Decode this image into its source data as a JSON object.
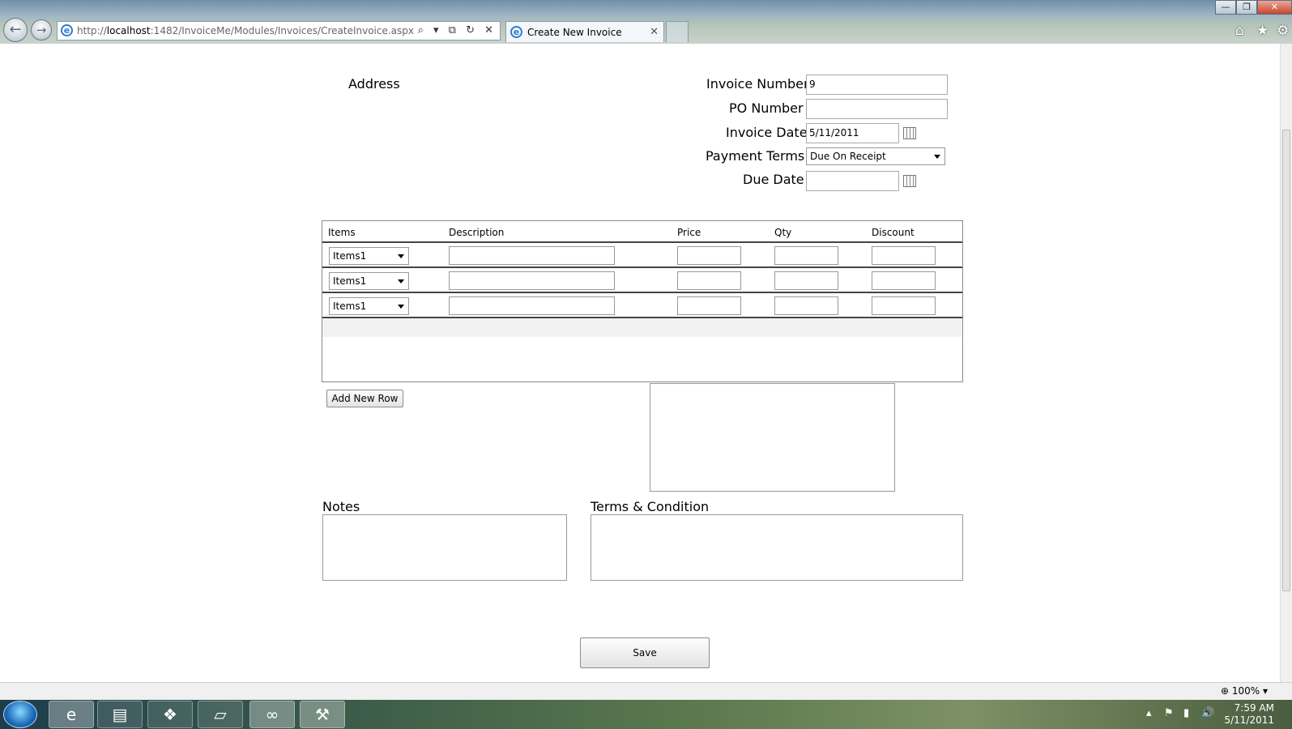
{
  "browser": {
    "address_prefix": "http://",
    "address_host": "localhost",
    "address_rest": ":1482/InvoiceMe/Modules/Invoices/CreateInvoice.aspx",
    "tab_title": "Create New Invoice",
    "tab_close": "✕",
    "back_glyph": "←",
    "forward_glyph": "→",
    "address_tools": "⌕ ▾ ⧉ ↻ ✕",
    "min_glyph": "—",
    "max_glyph": "❐",
    "close_glyph": "✕",
    "home_glyph": "⌂",
    "fav_glyph": "★",
    "tools_glyph": "⚙",
    "ie_glyph": "e"
  },
  "form": {
    "address_label": "Address",
    "invoice_number_label": "Invoice Number",
    "invoice_number_value": "9",
    "po_number_label": "PO Number",
    "po_number_value": "",
    "invoice_date_label": "Invoice Date",
    "invoice_date_value": "5/11/2011",
    "payment_terms_label": "Payment Terms",
    "payment_terms_value": "Due On Receipt",
    "due_date_label": "Due Date",
    "due_date_value": ""
  },
  "grid": {
    "columns": [
      "Items",
      "Description",
      "Price",
      "Qty",
      "Discount"
    ],
    "rows": [
      {
        "item": "Items1",
        "description": "",
        "price": "",
        "qty": "",
        "discount": ""
      },
      {
        "item": "Items1",
        "description": "",
        "price": "",
        "qty": "",
        "discount": ""
      },
      {
        "item": "Items1",
        "description": "",
        "price": "",
        "qty": "",
        "discount": ""
      }
    ]
  },
  "add_row_button": "Add New Row",
  "notes_label": "Notes",
  "terms_label": "Terms & Condition",
  "save_button": "Save",
  "statusbar": {
    "zoom": "100%",
    "zoom_arrow": "▾"
  },
  "taskbar": {
    "time": "7:59 AM",
    "date": "5/11/2011",
    "items": [
      {
        "icon": "internet-explorer-icon",
        "glyph": "e"
      },
      {
        "icon": "folder-icon",
        "glyph": "▤"
      },
      {
        "icon": "dropbox-icon",
        "glyph": "❖"
      },
      {
        "icon": "notepad-icon",
        "glyph": "▱"
      },
      {
        "icon": "visual-studio-icon",
        "glyph": "∞"
      },
      {
        "icon": "tools-icon",
        "glyph": "⚒"
      }
    ],
    "tray_glyphs": [
      "▴",
      "⚑",
      "▮",
      "🔊"
    ]
  }
}
